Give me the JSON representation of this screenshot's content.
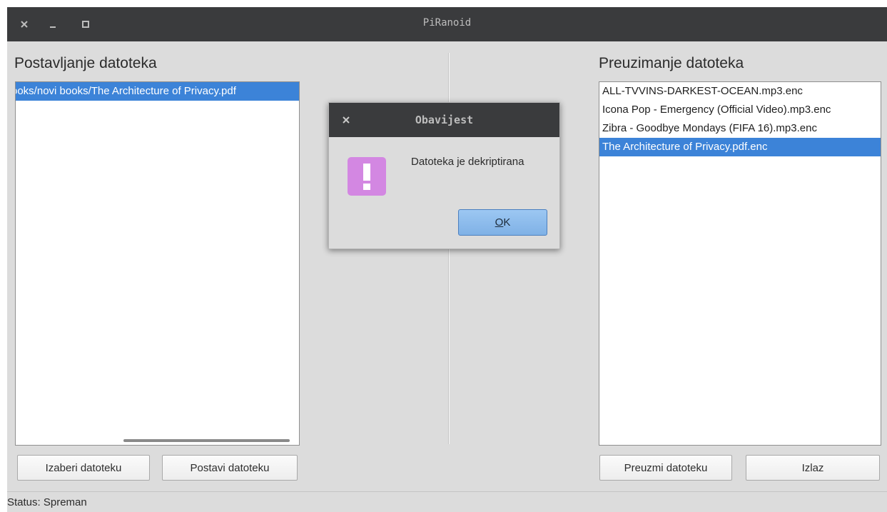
{
  "window": {
    "title": "PiRanoid"
  },
  "upload": {
    "title": "Postavljanje datoteka",
    "items": [
      {
        "label": "books/novi books/The Architecture of Privacy.pdf",
        "visible_label": "ooks/novi books/The Architecture of Privacy.pdf",
        "selected": true
      }
    ],
    "choose_button": "Izaberi datoteku",
    "upload_button": "Postavi datoteku"
  },
  "download": {
    "title": "Preuzimanje datoteka",
    "items": [
      {
        "label": "ALL-TVVINS-DARKEST-OCEAN.mp3.enc",
        "selected": false
      },
      {
        "label": "Icona Pop - Emergency (Official Video).mp3.enc",
        "selected": false
      },
      {
        "label": "Zibra - Goodbye Mondays (FIFA 16).mp3.enc",
        "selected": false
      },
      {
        "label": "The Architecture of Privacy.pdf.enc",
        "selected": true
      }
    ],
    "download_button": "Preuzmi datoteku",
    "exit_button": "Izlaz"
  },
  "status": {
    "text": "Status: Spreman"
  },
  "dialog": {
    "title": "Obavijest",
    "message": "Datoteka je dekriptirana",
    "ok_mnemonic": "O",
    "ok_rest": "K",
    "icon": "warning-exclamation-icon",
    "icon_color": "#d387e2"
  },
  "colors": {
    "selection": "#3c83d8",
    "titlebar": "#3a3b3d",
    "background": "#dcdcdc"
  }
}
